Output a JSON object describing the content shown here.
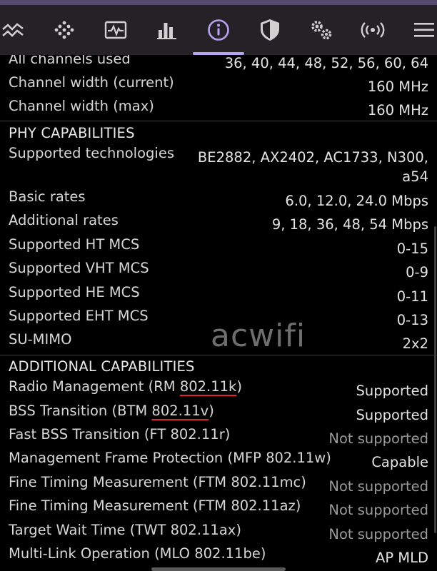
{
  "tabs": [
    {
      "icon": "signal-graph-icon"
    },
    {
      "icon": "channel-grid-icon"
    },
    {
      "icon": "spectrum-icon"
    },
    {
      "icon": "bar-chart-icon"
    },
    {
      "icon": "info-icon",
      "active": true
    },
    {
      "icon": "shield-icon"
    },
    {
      "icon": "gears-icon"
    },
    {
      "icon": "broadcast-icon"
    },
    {
      "icon": "list-menu-icon"
    }
  ],
  "channels": {
    "all_used_label": "All channels used",
    "all_used_value": "36, 40, 44, 48, 52, 56, 60, 64",
    "width_current_label": "Channel width (current)",
    "width_current_value": "160 MHz",
    "width_max_label": "Channel width (max)",
    "width_max_value": "160 MHz"
  },
  "phy": {
    "title": "PHY CAPABILITIES",
    "rows": [
      {
        "label": "Supported technologies",
        "value_line1": "BE2882, AX2402, AC1733, N300,",
        "value_line2": "a54"
      },
      {
        "label": "Basic rates",
        "value": "6.0, 12.0, 24.0 Mbps"
      },
      {
        "label": "Additional rates",
        "value": "9, 18, 36, 48, 54 Mbps"
      },
      {
        "label": "Supported HT MCS",
        "value": "0-15"
      },
      {
        "label": "Supported VHT MCS",
        "value": "0-9"
      },
      {
        "label": "Supported HE MCS",
        "value": "0-11"
      },
      {
        "label": "Supported EHT MCS",
        "value": "0-13"
      },
      {
        "label": "SU-MIMO",
        "value": "2x2"
      }
    ]
  },
  "additional": {
    "title": "ADDITIONAL CAPABILITIES",
    "rows": [
      {
        "label_pre": "Radio Management (RM ",
        "label_ul": "802.11k",
        "label_post": ")",
        "value": "Supported"
      },
      {
        "label_pre": "BSS Transition (BTM ",
        "label_ul": "802.11v",
        "label_post": ")",
        "value": "Supported"
      },
      {
        "label": "Fast BSS Transition (FT 802.11r)",
        "value": "Not supported"
      },
      {
        "label": "Management Frame Protection (MFP 802.11w)",
        "value": "Capable"
      },
      {
        "label": "Fine Timing Measurement (FTM 802.11mc)",
        "value": "Not supported"
      },
      {
        "label": "Fine Timing Measurement (FTM 802.11az)",
        "value": "Not supported"
      },
      {
        "label": "Target Wait Time (TWT 802.11ax)",
        "value": "Not supported"
      },
      {
        "label": "Multi-Link Operation (MLO 802.11be)",
        "value": "AP MLD"
      }
    ]
  },
  "watermark": "acwifi",
  "colors": {
    "accent": "#b9a2ef",
    "tabbar": "#242127",
    "background": "#000000",
    "underline": "#e0282e"
  }
}
